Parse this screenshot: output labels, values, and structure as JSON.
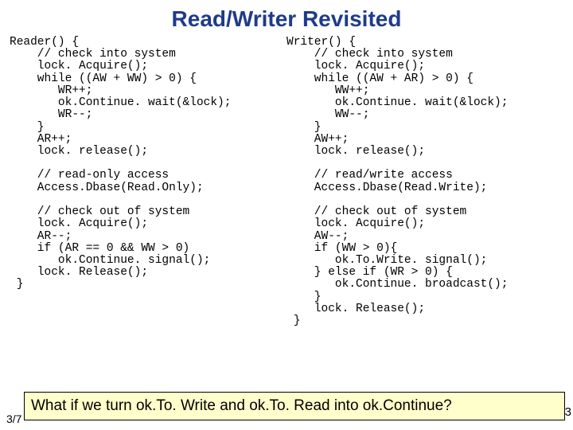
{
  "title": "Read/Writer Revisited",
  "reader_code": "Reader() {\n    // check into system\n    lock. Acquire();\n    while ((AW + WW) > 0) {\n       WR++;\n       ok.Continue. wait(&lock);\n       WR--;\n    }\n    AR++;\n    lock. release();\n\n    // read-only access\n    Access.Dbase(Read.Only);\n\n    // check out of system\n    lock. Acquire();\n    AR--;\n    if (AR == 0 && WW > 0)\n       ok.Continue. signal();\n    lock. Release();\n }",
  "writer_code": "Writer() {\n    // check into system\n    lock. Acquire();\n    while ((AW + AR) > 0) {\n       WW++;\n       ok.Continue. wait(&lock);\n       WW--;\n    }\n    AW++;\n    lock. release();\n\n    // read/write access\n    Access.Dbase(Read.Write);\n\n    // check out of system\n    lock. Acquire();\n    AW--;\n    if (WW > 0){\n       ok.To.Write. signal();\n    } else if (WR > 0) {\n       ok.Continue. broadcast();\n    }\n    lock. Release();\n }",
  "question": "What if we turn ok.To. Write and ok.To. Read into ok.Continue?",
  "page": "3/7",
  "right_fragment": "3"
}
